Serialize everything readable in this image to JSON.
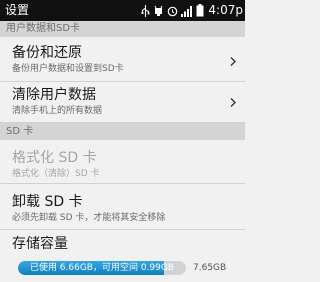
{
  "status_bar": {
    "title": "设置",
    "time": "4:07p"
  },
  "sections": {
    "user_data": "用户数据和SD卡",
    "sd_card": "SD 卡"
  },
  "items": [
    {
      "title": "备份和还原",
      "subtitle": "备份用户数据和设置到SD卡"
    },
    {
      "title": "清除用户数据",
      "subtitle": "清除手机上的所有数据"
    },
    {
      "title": "格式化 SD 卡",
      "subtitle": "格式化（清除）SD 卡"
    },
    {
      "title": "卸载 SD 卡",
      "subtitle": "必须先卸载 SD 卡，才能将其安全移除"
    }
  ],
  "storage": {
    "title": "存储容量",
    "bar_label": "已使用 6.66GB，可用空间 0.99GB",
    "total": "7.65GB",
    "used_fraction": 0.87
  },
  "colors": {
    "bar_fill": "#1e90d6",
    "status_bar": "#111111"
  }
}
